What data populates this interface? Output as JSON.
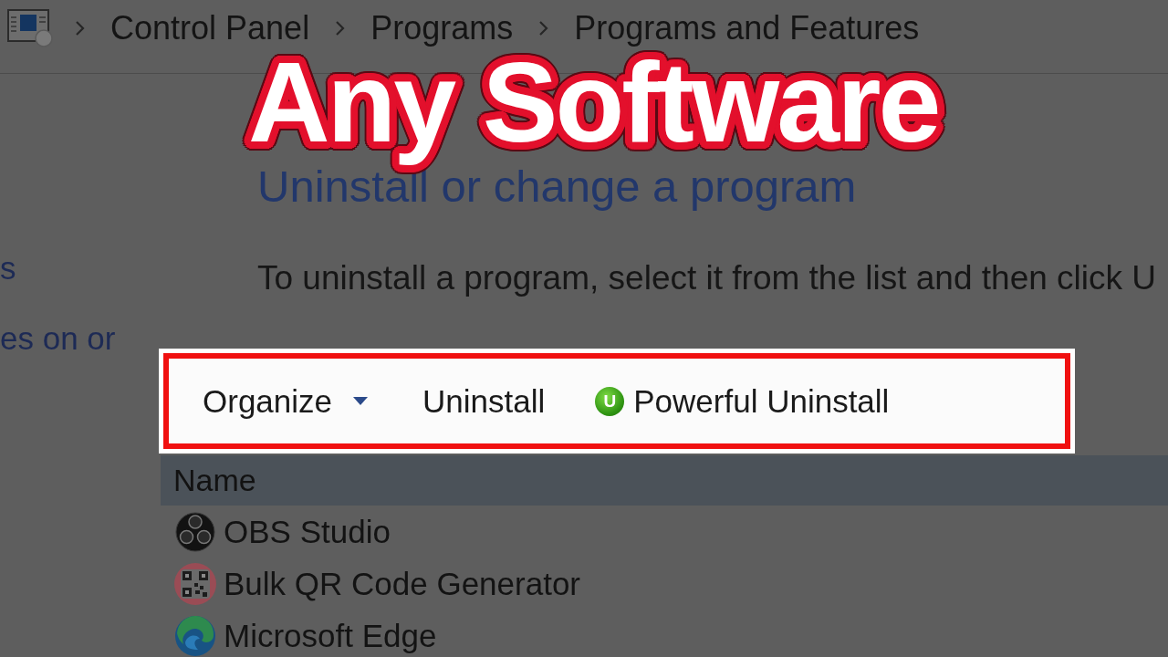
{
  "breadcrumb": {
    "items": [
      "Control Panel",
      "Programs",
      "Programs and Features"
    ]
  },
  "overlay": {
    "headline": "Any Software"
  },
  "sidebar": {
    "links": [
      "s",
      "es on or"
    ]
  },
  "main": {
    "heading": "Uninstall or change a program",
    "instruction": "To uninstall a program, select it from the list and then click U"
  },
  "toolbar": {
    "highlighted": true,
    "items": [
      {
        "kind": "menu",
        "label": "Organize"
      },
      {
        "kind": "plain",
        "label": "Uninstall"
      },
      {
        "kind": "logo",
        "label": "Powerful Uninstall",
        "logo_letter": "U"
      }
    ]
  },
  "table": {
    "columns": [
      "Name"
    ],
    "rows": [
      {
        "kind": "obs",
        "name": "OBS Studio"
      },
      {
        "kind": "qr",
        "name": "Bulk QR Code Generator"
      },
      {
        "kind": "edge",
        "name": "Microsoft Edge"
      }
    ]
  }
}
